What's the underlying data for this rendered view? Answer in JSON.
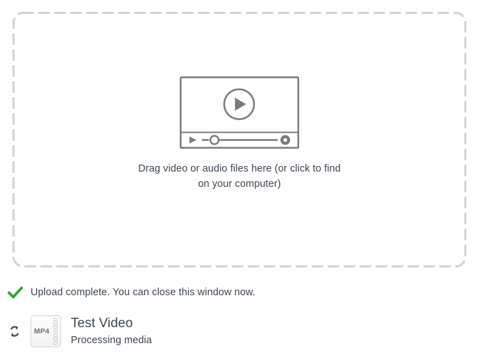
{
  "dropzone": {
    "icon_name": "video-player-icon",
    "prompt_line1": "Drag video or audio files here (or click to find",
    "prompt_line2": "on your computer)",
    "border_color": "#d2d2d2",
    "icon_color": "#7b7b7b"
  },
  "status": {
    "icon_name": "green-check-icon",
    "message": "Upload complete. You can close this window now.",
    "check_color": "#2aa02a",
    "text_color": "#3c4550"
  },
  "file": {
    "spinner_icon_name": "processing-spinner-icon",
    "thumb_icon_name": "mp4-file-icon",
    "extension_label": "MP4",
    "title": "Test Video",
    "subtitle": "Processing media",
    "perforation_count": 7
  }
}
